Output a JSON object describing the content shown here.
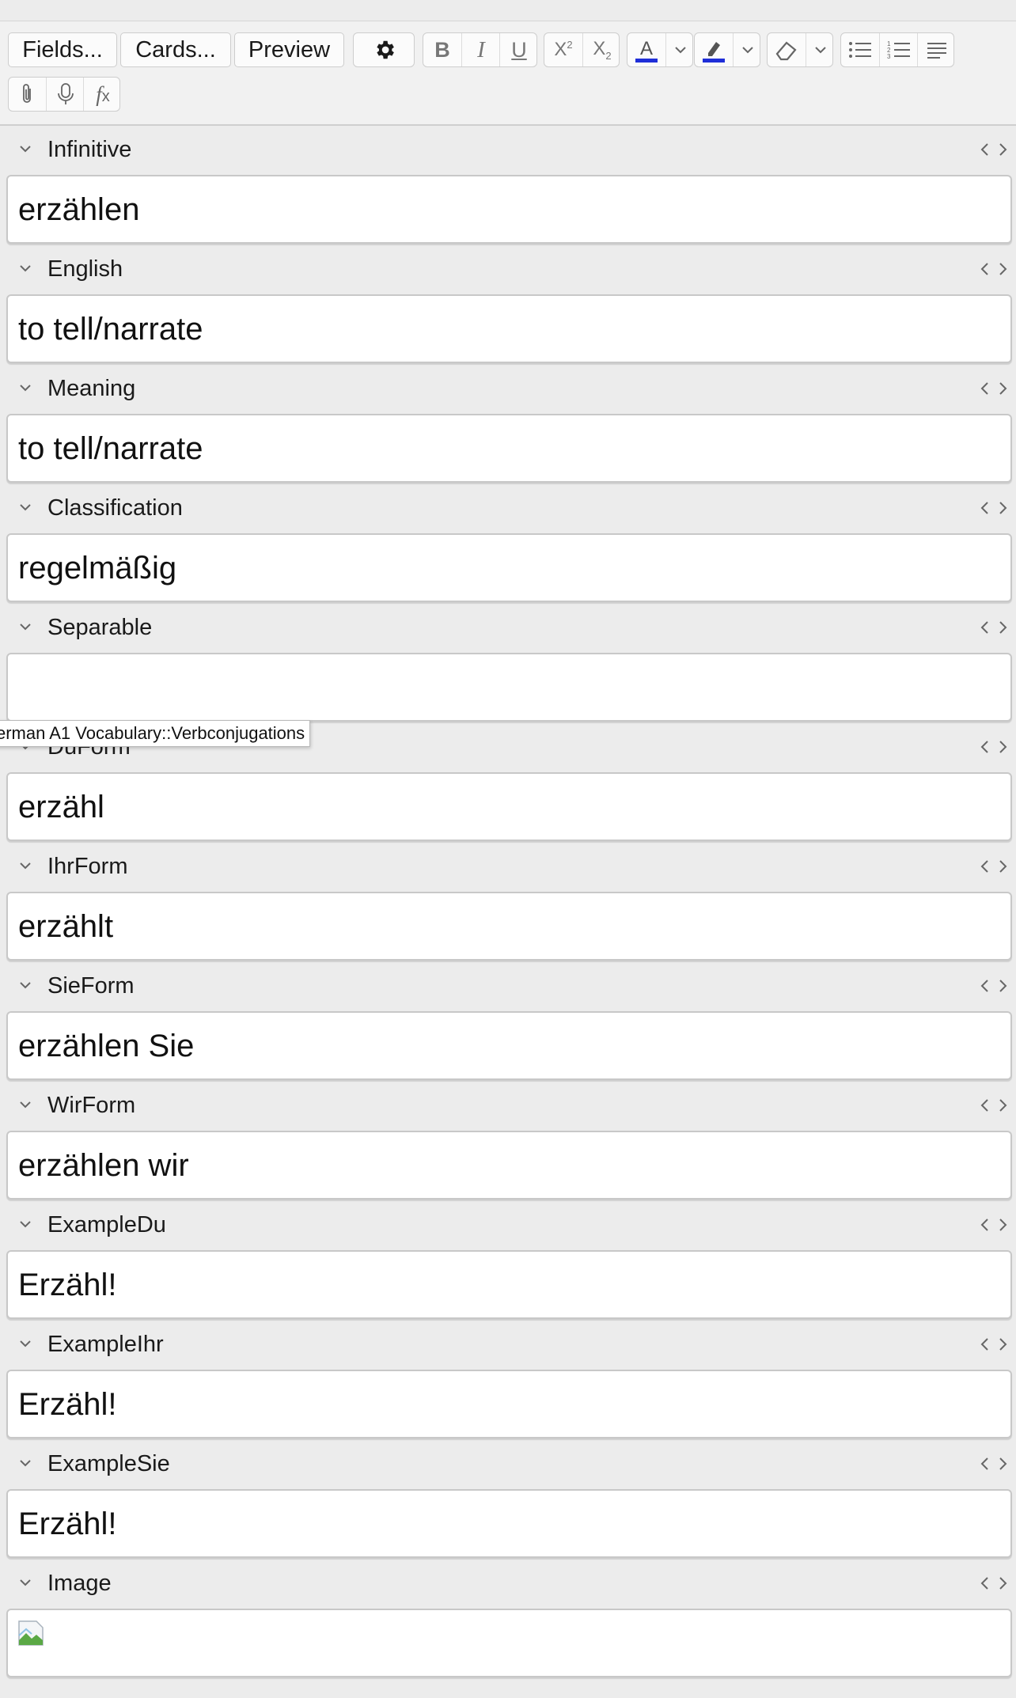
{
  "toolbar": {
    "fields_label": "Fields...",
    "cards_label": "Cards...",
    "preview_label": "Preview",
    "settings_icon": "gear-icon",
    "format_buttons": [
      "bold-icon",
      "italic-icon",
      "underline-icon",
      "superscript-icon",
      "subscript-icon",
      "text-color-icon",
      "highlight-icon",
      "eraser-icon",
      "bullet-list-icon",
      "numbered-list-icon",
      "align-icon",
      "attachment-icon",
      "microphone-icon",
      "formula-icon"
    ],
    "text_color": "#1f2ed8",
    "highlight_color": "#1f2ed8"
  },
  "fields": [
    {
      "label": "Infinitive",
      "value": "erzählen"
    },
    {
      "label": "English",
      "value": "to tell/narrate"
    },
    {
      "label": "Meaning",
      "value": "to tell/narrate"
    },
    {
      "label": "Classification",
      "value": "regelmäßig"
    },
    {
      "label": "Separable",
      "value": ""
    },
    {
      "label": "DuForm",
      "value": "erzähl"
    },
    {
      "label": "IhrForm",
      "value": "erzählt"
    },
    {
      "label": "SieForm",
      "value": "erzählen Sie"
    },
    {
      "label": "WirForm",
      "value": "erzählen wir"
    },
    {
      "label": "ExampleDu",
      "value": "Erzähl!"
    },
    {
      "label": "ExampleIhr",
      "value": "Erzähl!"
    },
    {
      "label": "ExampleSie",
      "value": "Erzähl!"
    },
    {
      "label": "Image",
      "value": ""
    }
  ],
  "tooltip": {
    "text": "erman A1 Vocabulary::Verbconjugations"
  }
}
